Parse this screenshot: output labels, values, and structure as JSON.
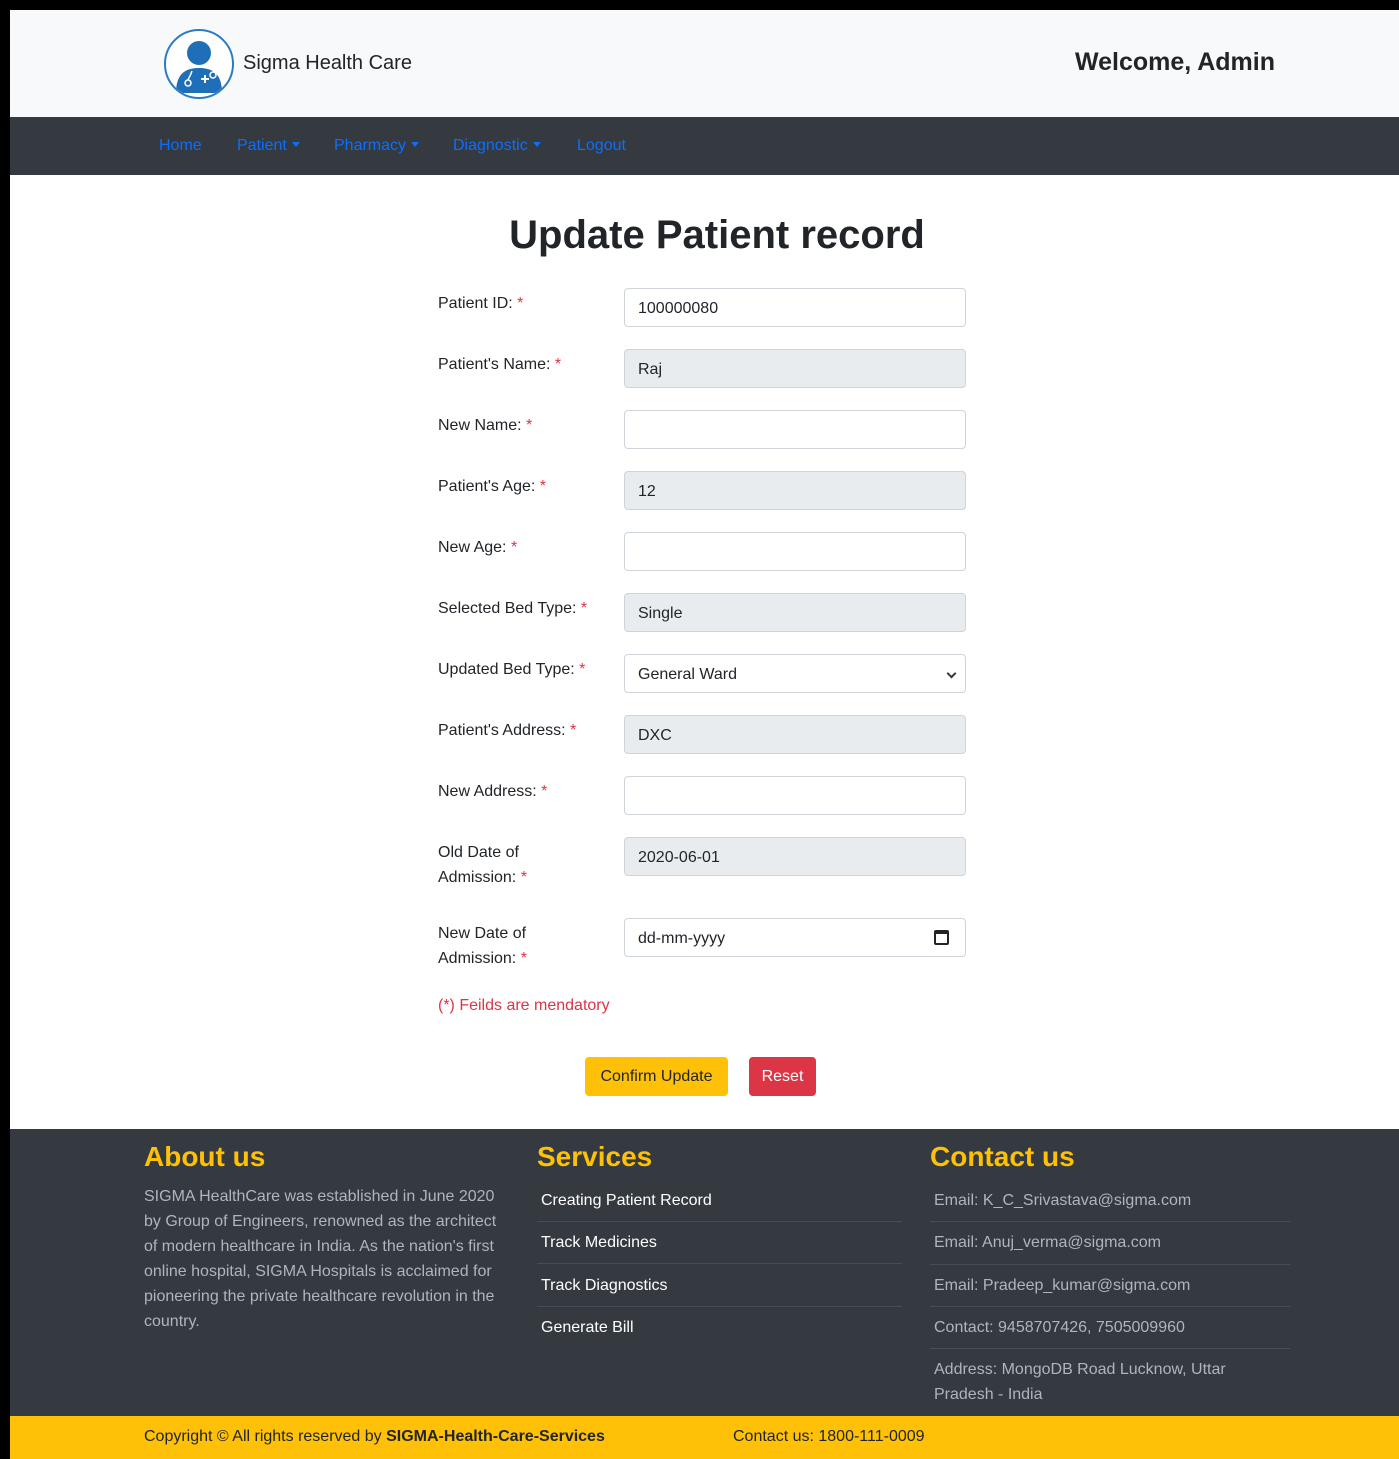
{
  "header": {
    "brand": "Sigma Health Care",
    "welcome": "Welcome, Admin"
  },
  "nav": {
    "home": "Home",
    "patient": "Patient",
    "pharmacy": "Pharmacy",
    "diagnostic": "Diagnostic",
    "logout": "Logout"
  },
  "form": {
    "title": "Update Patient record",
    "fields": {
      "patient_id": {
        "label": "Patient ID:",
        "value": "100000080"
      },
      "patient_name": {
        "label": "Patient's Name:",
        "value": "Raj"
      },
      "new_name": {
        "label": "New Name:",
        "value": ""
      },
      "patient_age": {
        "label": "Patient's Age:",
        "value": "12"
      },
      "new_age": {
        "label": "New Age:",
        "value": ""
      },
      "selected_bed": {
        "label": "Selected Bed Type:",
        "value": "Single"
      },
      "updated_bed": {
        "label": "Updated Bed Type:",
        "value": "General Ward"
      },
      "patient_address": {
        "label": "Patient's Address:",
        "value": "DXC"
      },
      "new_address": {
        "label": "New Address:",
        "value": ""
      },
      "old_doa": {
        "label": "Old Date of Admission:",
        "value": "2020-06-01"
      },
      "new_doa": {
        "label": "New Date of Admission:",
        "placeholder": "dd-mm-yyyy"
      }
    },
    "required_mark": "*",
    "note": "(*) Feilds are mendatory",
    "confirm_label": "Confirm Update",
    "reset_label": "Reset"
  },
  "footer": {
    "about_title": "About us",
    "about_text": "SIGMA HealthCare was established in June 2020 by Group of Engineers, renowned as the architect of modern healthcare in India. As the nation's first online hospital, SIGMA Hospitals is acclaimed for pioneering the private healthcare revolution in the country.",
    "services_title": "Services",
    "services": [
      "Creating Patient Record",
      "Track Medicines",
      "Track Diagnostics",
      "Generate Bill"
    ],
    "contact_title": "Contact us",
    "contacts": [
      "Email: K_C_Srivastava@sigma.com",
      "Email: Anuj_verma@sigma.com",
      "Email: Pradeep_kumar@sigma.com",
      "Contact: 9458707426, 7505009960",
      "Address: MongoDB Road Lucknow, Uttar Pradesh - India"
    ],
    "copyright_prefix": "Copyright © All rights reserved by ",
    "copyright_brand": "SIGMA-Health-Care-Services",
    "contact_line": "Contact us: 1800-111-0009"
  },
  "colors": {
    "accent": "#ffc107",
    "danger": "#dc3545",
    "dark": "#343a40",
    "link": "#0d6efd"
  }
}
